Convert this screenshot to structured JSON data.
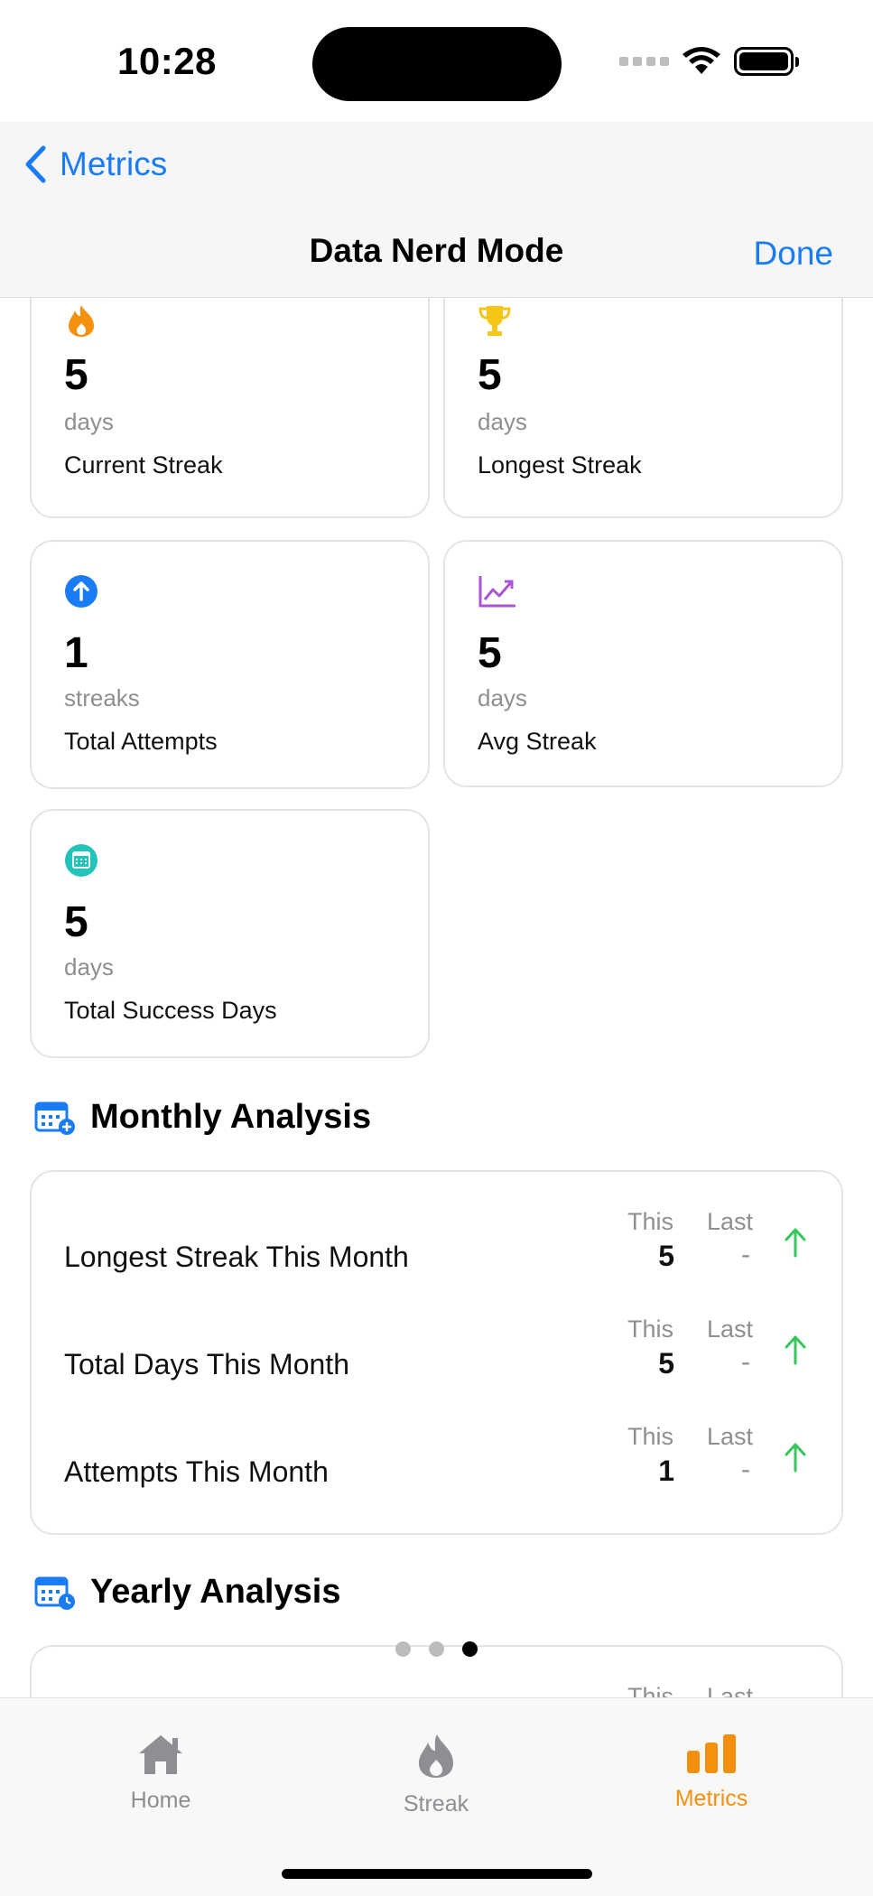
{
  "status_bar": {
    "time": "10:28"
  },
  "nav": {
    "back_label": "Metrics",
    "title": "Data Nerd Mode",
    "done_label": "Done"
  },
  "stats": [
    {
      "value": "5",
      "unit": "days",
      "label": "Current Streak",
      "icon": "flame-icon",
      "color": "#f3910f"
    },
    {
      "value": "5",
      "unit": "days",
      "label": "Longest Streak",
      "icon": "trophy-icon",
      "color": "#f5c518"
    },
    {
      "value": "1",
      "unit": "streaks",
      "label": "Total Attempts",
      "icon": "arrow-up-circle-icon",
      "color": "#1a7cf5"
    },
    {
      "value": "5",
      "unit": "days",
      "label": "Avg Streak",
      "icon": "chart-line-icon",
      "color": "#a855d6"
    },
    {
      "value": "5",
      "unit": "days",
      "label": "Total Success Days",
      "icon": "calendar-circle-icon",
      "color": "#22c3b8"
    }
  ],
  "monthly": {
    "title": "Monthly Analysis",
    "col_this": "This",
    "col_last": "Last",
    "rows": [
      {
        "label": "Longest Streak This Month",
        "this": "5",
        "last": "-"
      },
      {
        "label": "Total Days This Month",
        "this": "5",
        "last": "-"
      },
      {
        "label": "Attempts This Month",
        "this": "1",
        "last": "-"
      }
    ]
  },
  "yearly": {
    "title": "Yearly Analysis",
    "col_this": "This",
    "col_last": "Last"
  },
  "page_indicator": {
    "count": 3,
    "active_index": 2
  },
  "tabs": [
    {
      "label": "Home",
      "icon": "house-icon",
      "active": false
    },
    {
      "label": "Streak",
      "icon": "flame-icon",
      "active": false
    },
    {
      "label": "Metrics",
      "icon": "bar-chart-icon",
      "active": true
    }
  ],
  "colors": {
    "accent": "#1a7cf5",
    "tab_active": "#f3910f",
    "trend_up": "#34c759"
  }
}
